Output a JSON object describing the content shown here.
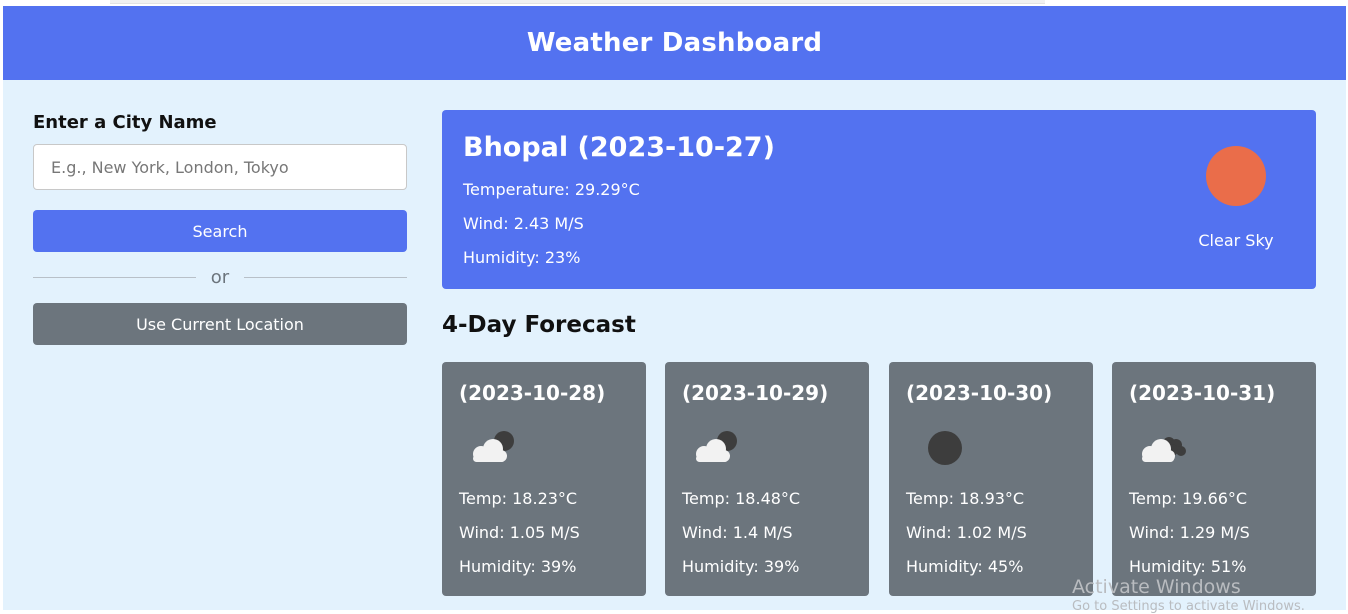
{
  "header": {
    "title": "Weather Dashboard"
  },
  "search_panel": {
    "label": "Enter a City Name",
    "input_placeholder": "E.g., New York, London, Tokyo",
    "input_value": "",
    "search_button": "Search",
    "divider_text": "or",
    "location_button": "Use Current Location"
  },
  "current": {
    "city_date": "Bhopal (2023-10-27)",
    "temperature": "Temperature: 29.29°C",
    "wind": "Wind: 2.43 M/S",
    "humidity": "Humidity: 23%",
    "description": "Clear Sky",
    "icon": "sun-icon"
  },
  "forecast": {
    "title": "4-Day Forecast",
    "days": [
      {
        "date": "(2023-10-28)",
        "icon": "cloud-moon-icon",
        "temp": "Temp: 18.23°C",
        "wind": "Wind: 1.05 M/S",
        "humidity": "Humidity: 39%"
      },
      {
        "date": "(2023-10-29)",
        "icon": "cloud-moon-icon",
        "temp": "Temp: 18.48°C",
        "wind": "Wind: 1.4 M/S",
        "humidity": "Humidity: 39%"
      },
      {
        "date": "(2023-10-30)",
        "icon": "moon-icon",
        "temp": "Temp: 18.93°C",
        "wind": "Wind: 1.02 M/S",
        "humidity": "Humidity: 45%"
      },
      {
        "date": "(2023-10-31)",
        "icon": "clouds-icon",
        "temp": "Temp: 19.66°C",
        "wind": "Wind: 1.29 M/S",
        "humidity": "Humidity: 51%"
      }
    ]
  },
  "watermark": {
    "line1": "Activate Windows",
    "line2": "Go to Settings to activate Windows."
  },
  "colors": {
    "primary": "#5372f0",
    "secondary": "#6c757d",
    "background": "#e3f2fd",
    "sun": "#ea6d4a"
  }
}
